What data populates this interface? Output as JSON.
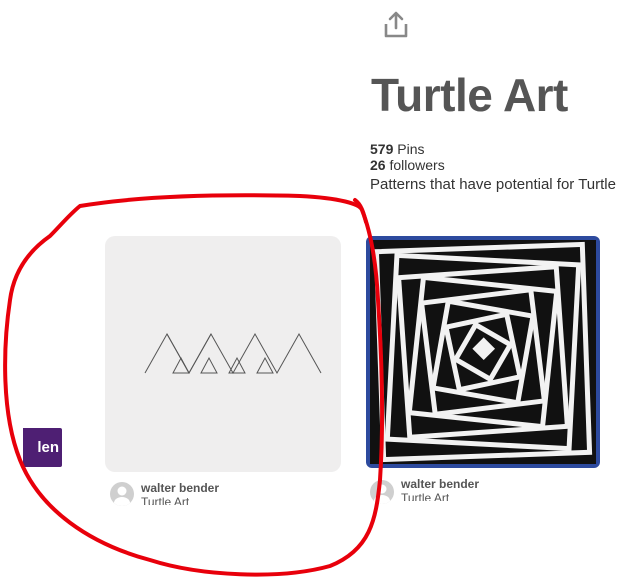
{
  "header": {
    "share_icon": "share-upload-icon"
  },
  "board": {
    "title": "Turtle Art",
    "pins_count": "579",
    "pins_label": "Pins",
    "followers_count": "26",
    "followers_label": "followers",
    "description": "Patterns that have potential for Turtle"
  },
  "pins": [
    {
      "pinner_name": "walter bender",
      "board_name": "Turtle Art",
      "image": "triangles-pattern"
    },
    {
      "pinner_name": "walter bender",
      "board_name": "Turtle Art",
      "image": "op-art-squares"
    }
  ],
  "follow_button": {
    "label": "len",
    "color": "#4e1f73"
  },
  "annotation": {
    "color": "#e8000b",
    "shape": "freehand-circle"
  }
}
